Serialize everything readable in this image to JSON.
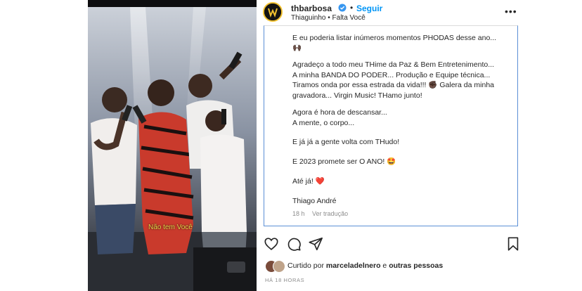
{
  "photo": {
    "subtitle": "Não tem Você"
  },
  "header": {
    "username": "thbarbosa",
    "separator": "•",
    "follow_label": "Seguir",
    "subline": "Thiaguinho • Falta Você",
    "more_label": "•••"
  },
  "caption": {
    "lines": [
      "E eu poderia listar inúmeros momentos PHODAS desse ano...",
      "🙌🏿",
      "Agradeço a todo meu THime da Paz & Bem Entretenimento...",
      "A minha BANDA DO PODER... Produção e Equipe técnica...",
      "Tiramos onda por essa estrada da vida!!! ✊🏿 Galera da minha",
      "gravadora... Virgin Music! THamo junto!",
      "Agora é hora de descansar...",
      "A mente, o corpo...",
      "E já já a gente volta com THudo!",
      "E 2023 promete ser O ANO! 🤩",
      "Até já! ❤️",
      "Thiago André"
    ],
    "age": "18 h",
    "translate_label": "Ver tradução"
  },
  "actions": {
    "like": "heart-icon",
    "comment": "comment-icon",
    "share": "share-icon",
    "save": "bookmark-icon"
  },
  "likes": {
    "prefix": "Curtido por",
    "user": "marceladelnero",
    "conj": "e",
    "others": "outras pessoas"
  },
  "timestamp": "HÁ 18 HORAS",
  "colors": {
    "link": "#0095f6",
    "verified": "#3897f0",
    "text": "#262626",
    "muted": "#8e8e8e"
  }
}
